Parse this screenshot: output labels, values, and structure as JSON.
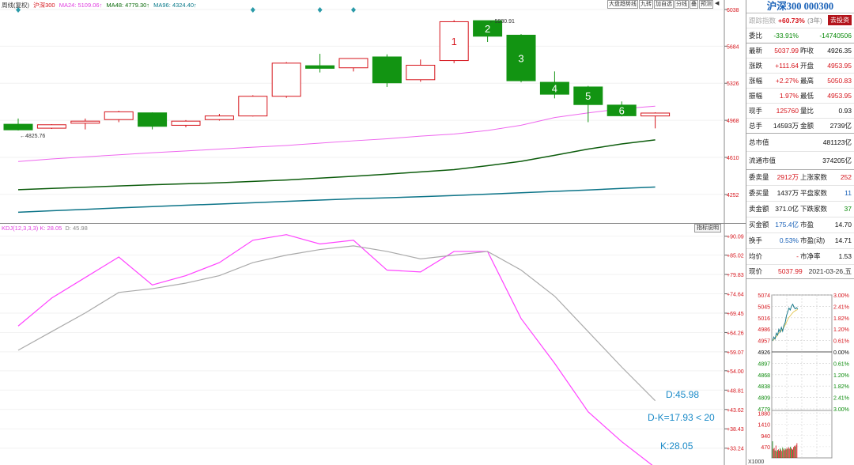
{
  "main_legend": {
    "label1": "周线(复权)",
    "label2": "沪深300",
    "ma24": "MA24: 5109.06↑",
    "ma48": "MA48: 4779.30↑",
    "ma96": "MA96: 4324.40↑"
  },
  "toolbar": [
    "大盘趋势线",
    "九转",
    "加自选",
    "分线",
    "叠",
    "预测"
  ],
  "kdj_legend": {
    "label": "KDJ(12,3,3,3) K: 28.05",
    "d": "D: 45.98"
  },
  "kdj_button": "指标说明",
  "chart_data": [
    {
      "type": "candlestick",
      "ylim": [
        4068,
        6038
      ],
      "y_ticks": [
        6038,
        5684,
        5326,
        4968,
        4610,
        4252
      ],
      "candles": [
        {
          "o": 4930,
          "h": 4985,
          "l": 4870,
          "c": 4876
        },
        {
          "o": 4892,
          "h": 4930,
          "l": 4885,
          "c": 4925
        },
        {
          "o": 4940,
          "h": 4985,
          "l": 4880,
          "c": 4960
        },
        {
          "o": 4975,
          "h": 5060,
          "l": 4950,
          "c": 5050
        },
        {
          "o": 5040,
          "h": 5045,
          "l": 4880,
          "c": 4910
        },
        {
          "o": 4920,
          "h": 4970,
          "l": 4900,
          "c": 4960
        },
        {
          "o": 4975,
          "h": 5030,
          "l": 4965,
          "c": 5010
        },
        {
          "o": 5010,
          "h": 5210,
          "l": 5005,
          "c": 5200
        },
        {
          "o": 5200,
          "h": 5530,
          "l": 5185,
          "c": 5520
        },
        {
          "o": 5495,
          "h": 5610,
          "l": 5430,
          "c": 5470
        },
        {
          "o": 5475,
          "h": 5565,
          "l": 5440,
          "c": 5565
        },
        {
          "o": 5580,
          "h": 5605,
          "l": 5290,
          "c": 5330
        },
        {
          "o": 5360,
          "h": 5555,
          "l": 5340,
          "c": 5500
        },
        {
          "o": 5545,
          "h": 5935,
          "l": 5520,
          "c": 5920
        },
        {
          "o": 5930,
          "h": 5931,
          "l": 5725,
          "c": 5780
        },
        {
          "o": 5790,
          "h": 5800,
          "l": 5335,
          "c": 5350
        },
        {
          "o": 5335,
          "h": 5440,
          "l": 5180,
          "c": 5220
        },
        {
          "o": 5290,
          "h": 5300,
          "l": 4950,
          "c": 5120
        },
        {
          "o": 5115,
          "h": 5150,
          "l": 5005,
          "c": 5012
        },
        {
          "o": 5010,
          "h": 5045,
          "l": 4890,
          "c": 5037.99
        }
      ],
      "nine_turn": [
        {
          "i": 13,
          "n": "1"
        },
        {
          "i": 14,
          "n": "2"
        },
        {
          "i": 15,
          "n": "3"
        },
        {
          "i": 16,
          "n": "4"
        },
        {
          "i": 17,
          "n": "5"
        },
        {
          "i": 18,
          "n": "6"
        }
      ],
      "diamonds_at": [
        0,
        7,
        9,
        10
      ],
      "annotations": [
        {
          "text": "5930.91",
          "i": 14,
          "y": 5930.91
        },
        {
          "text": "4825.76",
          "i": 0,
          "y": 4825.76
        }
      ],
      "ma24": [
        4570,
        4595,
        4615,
        4635,
        4655,
        4672,
        4690,
        4708,
        4725,
        4748,
        4770,
        4790,
        4815,
        4835,
        4870,
        4920,
        4995,
        5040,
        5080,
        5105
      ],
      "ma48": [
        4298,
        4310,
        4322,
        4334,
        4346,
        4355,
        4365,
        4378,
        4392,
        4410,
        4428,
        4448,
        4470,
        4492,
        4530,
        4572,
        4630,
        4690,
        4740,
        4779
      ],
      "ma96": [
        4080,
        4095,
        4108,
        4122,
        4135,
        4148,
        4160,
        4172,
        4185,
        4198,
        4210,
        4220,
        4230,
        4242,
        4255,
        4268,
        4282,
        4295,
        4310,
        4324
      ]
    },
    {
      "type": "line",
      "ylim": [
        30,
        91.5
      ],
      "y_ticks": [
        "+90.09",
        "+85.02",
        "+79.83",
        "+74.64",
        "+69.45",
        "+64.26",
        "+59.07",
        "+54.00",
        "+48.81",
        "+43.62",
        "+38.43",
        "+33.24"
      ],
      "series": [
        {
          "name": "K",
          "values": [
            66,
            73.5,
            79,
            84.5,
            77,
            79.5,
            83,
            89,
            90.5,
            88,
            89,
            81,
            80.5,
            86,
            86,
            68,
            56,
            43,
            35,
            28.05
          ]
        },
        {
          "name": "D",
          "values": [
            59.5,
            64.5,
            69.5,
            75,
            76,
            77.5,
            79.5,
            83,
            85,
            86.5,
            87.5,
            86,
            84,
            85,
            86,
            81,
            74,
            64.5,
            55,
            45.98
          ]
        }
      ],
      "labels": {
        "d": "D:45.98",
        "diff": "D-K=17.93 < 20",
        "k": "K:28.05"
      }
    }
  ],
  "panel": {
    "title": "沪深300 000300",
    "track": {
      "label": "跟踪指数",
      "value": "+60.73%",
      "period": "(3年)",
      "button": "去投资"
    },
    "rows": [
      {
        "l1": "委比",
        "v1": "-33.91%",
        "l2": "",
        "v2": "-14740506"
      },
      {
        "l1": "最新",
        "v1": "5037.99",
        "l2": "昨收",
        "v2": "4926.35"
      },
      {
        "l1": "涨跌",
        "v1": "+111.64",
        "l2": "开盘",
        "v2": "4953.95"
      },
      {
        "l1": "涨幅",
        "v1": "+2.27%",
        "l2": "最高",
        "v2": "5050.83"
      },
      {
        "l1": "振幅",
        "v1": "1.97%",
        "l2": "最低",
        "v2": "4953.95"
      },
      {
        "l1": "现手",
        "v1": "125760",
        "l2": "量比",
        "v2": "0.93"
      },
      {
        "l1": "总手",
        "v1": "14593万",
        "l2": "金额",
        "v2": "2739亿"
      }
    ],
    "mv_rows": [
      {
        "label": "总市值",
        "value": "481123亿"
      },
      {
        "label": "流通市值",
        "value": "374205亿"
      }
    ],
    "stat_rows": [
      {
        "l1": "委卖量",
        "v1": "2912万",
        "l2": "上涨家数",
        "v2": "252"
      },
      {
        "l1": "委买量",
        "v1": "1437万",
        "l2": "平盘家数",
        "v2": "11"
      },
      {
        "l1": "卖金额",
        "v1": "371.0亿",
        "l2": "下跌家数",
        "v2": "37"
      },
      {
        "l1": "买金额",
        "v1": "175.4亿",
        "l2": "市盈",
        "v2": "14.70"
      },
      {
        "l1": "换手",
        "v1": "0.53%",
        "l2": "市盈(动)",
        "v2": "14.71"
      },
      {
        "l1": "均价",
        "v1": "-",
        "l2": "市净率",
        "v2": "1.53"
      }
    ],
    "now": {
      "label": "现价",
      "price": "5037.99",
      "date": "2021-03-26,五"
    },
    "mini_chart": {
      "type": "line",
      "left_ticks": [
        "5074",
        "5045",
        "5016",
        "4986",
        "4957",
        "4926",
        "4897",
        "4868",
        "4838",
        "4809",
        "4779"
      ],
      "right_ticks": [
        "3.00%",
        "2.41%",
        "1.82%",
        "1.20%",
        "0.61%",
        "0.00%",
        "0.61%",
        "1.20%",
        "1.82%",
        "2.41%",
        "3.00%"
      ],
      "ylim": [
        4779,
        5074
      ],
      "base": 4926,
      "price": [
        4955,
        4965,
        4960,
        4975,
        4970,
        4985,
        4978,
        4990,
        4980,
        4995,
        5002,
        5020,
        5030,
        5040,
        5035,
        5045,
        5050,
        5042,
        5038,
        5041,
        5037.99
      ],
      "avg": [
        4955,
        4958,
        4962,
        4966,
        4970,
        4975,
        4978,
        4982,
        4985,
        4990,
        4996,
        5003,
        5010,
        5016,
        5020,
        5024,
        5028,
        5031,
        5033,
        5035,
        5036
      ],
      "vol_ticks": [
        "1880",
        "1410",
        "940",
        "470"
      ],
      "vol_label": "X1000",
      "volume": [
        700,
        380,
        420,
        310,
        520,
        280,
        330,
        360,
        300,
        410,
        350,
        290,
        440,
        380,
        320,
        400,
        360,
        420,
        380,
        450,
        390,
        470,
        420,
        380,
        350,
        460,
        510,
        480,
        540,
        620
      ]
    }
  }
}
